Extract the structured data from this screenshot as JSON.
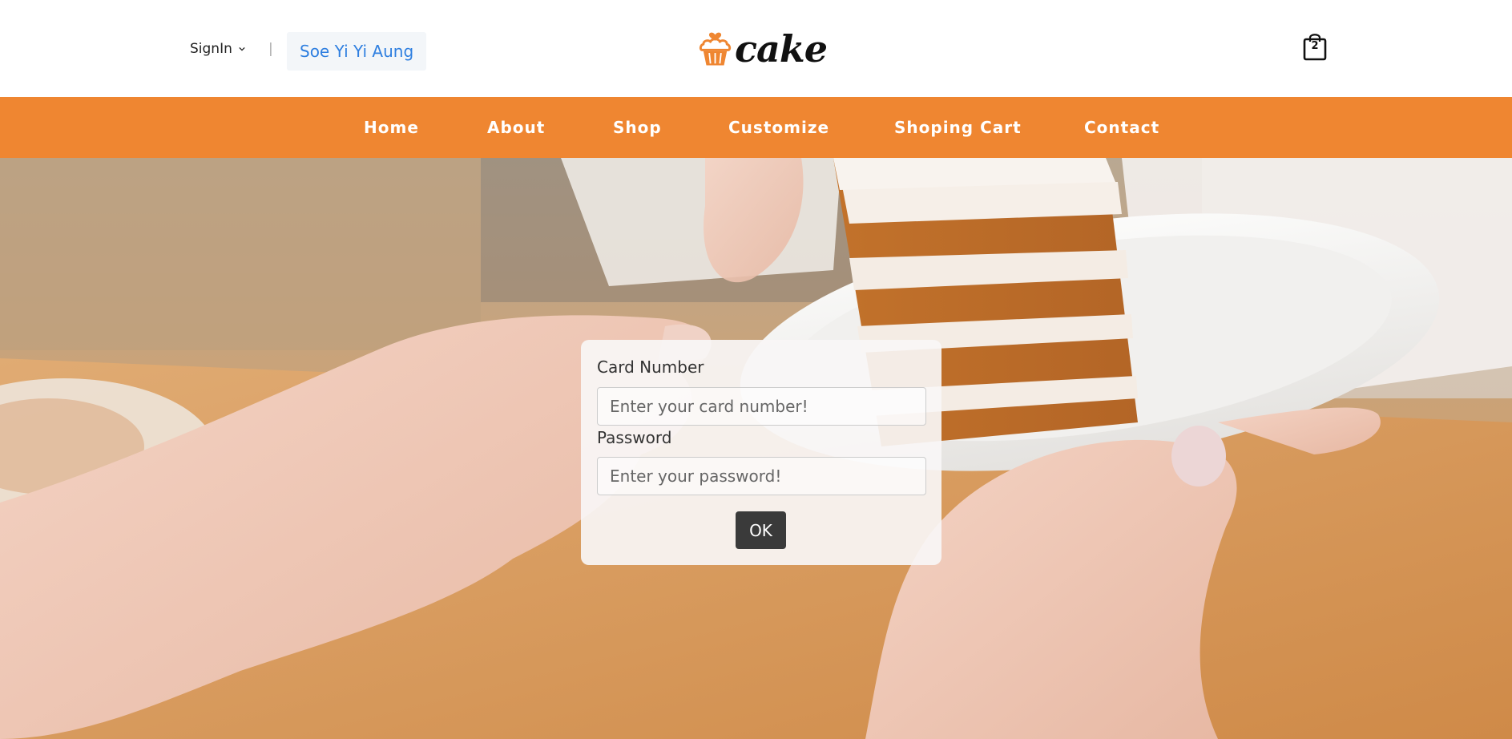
{
  "header": {
    "signin_label": "SignIn",
    "divider": "|",
    "username": "Soe Yi Yi Aung",
    "logo_text": "cake",
    "cart_count": "2"
  },
  "nav": {
    "items": [
      {
        "label": "Home"
      },
      {
        "label": "About"
      },
      {
        "label": "Shop"
      },
      {
        "label": "Customize"
      },
      {
        "label": "Shoping Cart"
      },
      {
        "label": "Contact"
      }
    ]
  },
  "form": {
    "card_label": "Card Number",
    "card_placeholder": "Enter your card number!",
    "card_value": "",
    "password_label": "Password",
    "password_placeholder": "Enter your password!",
    "password_value": "",
    "ok_label": "OK"
  },
  "colors": {
    "accent": "#ef8631",
    "nav_text": "#ffffff",
    "username_link": "#2f7fe0",
    "button_bg": "#3a3a3a"
  },
  "icons": {
    "logo": "cupcake-icon",
    "cart": "shopping-bag-icon",
    "signin_dropdown": "chevron-down-icon"
  }
}
